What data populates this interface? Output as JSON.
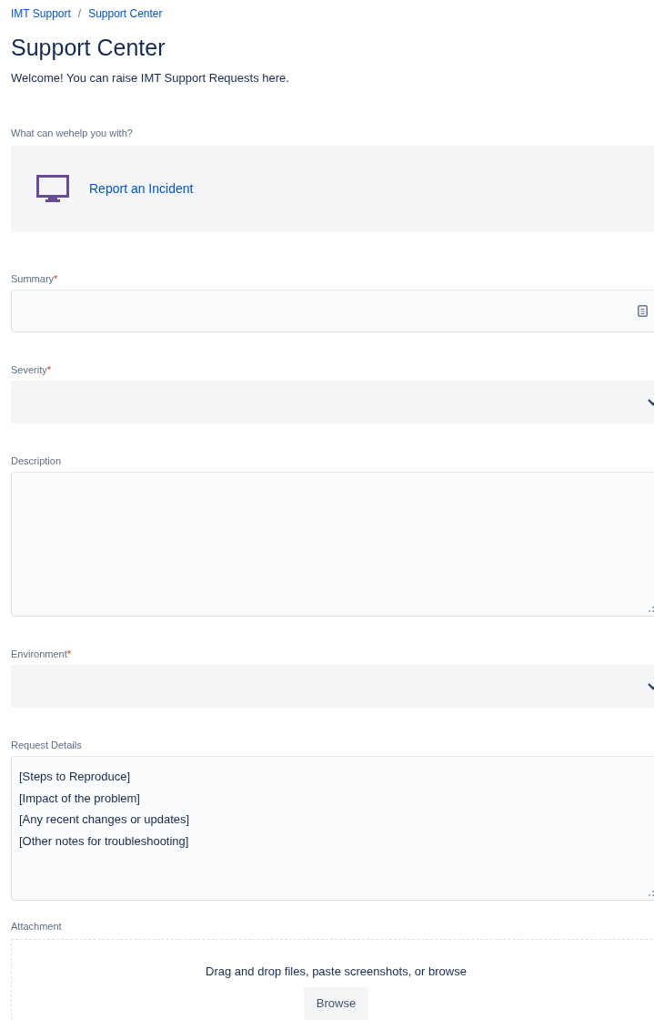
{
  "breadcrumbs": [
    "IMT Support",
    "Support Center"
  ],
  "breadcrumb_separator": "/",
  "title": "Support Center",
  "welcome": "Welcome! You can raise IMT Support Requests here.",
  "request_type": {
    "label": "What can wehelp you with?",
    "option": "Report an Incident"
  },
  "fields": [
    {
      "kind": "text",
      "label": "Summary",
      "required": true
    },
    {
      "kind": "select",
      "label": "Severity",
      "required": true
    },
    {
      "kind": "textarea",
      "label": "Description",
      "required": false
    },
    {
      "kind": "select",
      "label": "Environment",
      "required": true
    },
    {
      "kind": "textarea",
      "label": "Request Details",
      "required": false,
      "value": "[Steps to Reproduce]\n[Impact of the problem]\n[Any recent changes or updates]\n[Other notes for troubleshooting]"
    }
  ],
  "required_mark": "*",
  "attachment": {
    "label": "Attachment",
    "hint": "Drag and drop files, paste screenshots, or browse",
    "button": "Browse"
  }
}
